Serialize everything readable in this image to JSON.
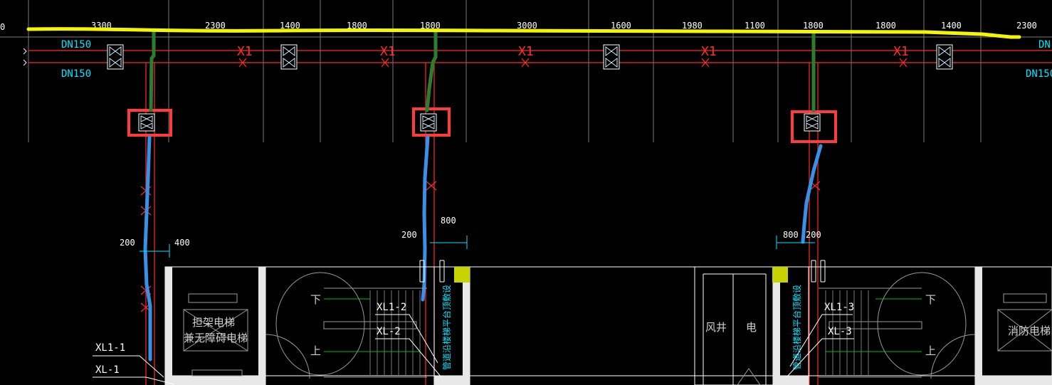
{
  "dimensions": {
    "top": [
      "3300",
      "2300",
      "1400",
      "1800",
      "1800",
      "3000",
      "1600",
      "1980",
      "1100",
      "1800",
      "1800",
      "1400",
      "2300"
    ],
    "left_edge": "0",
    "riser1": [
      "200",
      "400"
    ],
    "riser2": [
      "200",
      "800"
    ],
    "riser3": [
      "800",
      "200"
    ]
  },
  "pipe_sizes": {
    "left_upper": "DN150",
    "left_lower": "DN150",
    "right_upper": "DN",
    "right_lower": "DN150"
  },
  "valve_label": "X1",
  "stair_marks": {
    "down": "下",
    "up": "上"
  },
  "pipe_tags": {
    "xl1_1": "XL1-1",
    "xl_1": "XL-1",
    "xl1_2": "XL1-2",
    "xl_2": "XL-2",
    "xl1_3": "XL1-3",
    "xl_3": "XL-3"
  },
  "rooms": {
    "elevator_line1": "担架电梯",
    "elevator_line2": "兼无障碍电梯",
    "shaft": "风井",
    "electric": "电",
    "fire_elevator": "消防电梯"
  },
  "vertical_notes": {
    "note_left": "管道沿楼梯平台顶敷设",
    "note_right": "管道沿楼梯平台顶敷设"
  },
  "colors": {
    "background": "#000000",
    "pipe_red": "#ff2a2a",
    "highlight_yellow": "#f5f500",
    "markup_green": "#2e7d2e",
    "markup_blue": "#3a8fe6",
    "callout_red": "#ff3b3b",
    "text_cyan": "#00e5ff",
    "wall_white": "#ffffff"
  }
}
